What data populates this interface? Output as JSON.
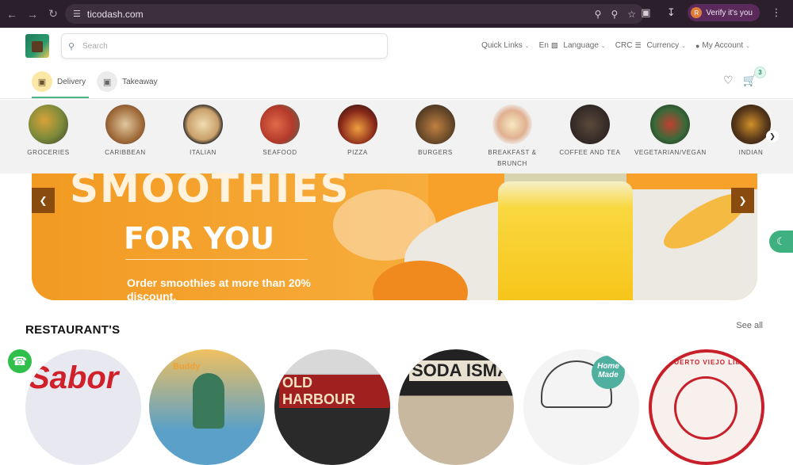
{
  "browser": {
    "url": "ticodash.com",
    "verify_label": "Verify it's you",
    "verify_avatar": "R"
  },
  "header": {
    "search_placeholder": "Search",
    "nav": {
      "quick_links": "Quick Links",
      "lang_code": "En",
      "language": "Language",
      "currency_code": "CRC",
      "currency": "Currency",
      "account": "My Account"
    },
    "modes": [
      {
        "label": "Delivery",
        "active": true
      },
      {
        "label": "Takeaway",
        "active": false
      }
    ],
    "cart_count": "3"
  },
  "categories": [
    {
      "label": "GROCERIES",
      "color": "#7a8a3a"
    },
    {
      "label": "CARIBBEAN",
      "color": "#a06b3a"
    },
    {
      "label": "ITALIAN",
      "color": "#c9a06a"
    },
    {
      "label": "SEAFOOD",
      "color": "#b33a2a"
    },
    {
      "label": "PIZZA",
      "color": "#8a2a1a"
    },
    {
      "label": "BURGERS",
      "color": "#6a4a2a"
    },
    {
      "label": "BREAKFAST & BRUNCH",
      "color": "#e0b090"
    },
    {
      "label": "COFFEE AND TEA",
      "color": "#3a2e2a"
    },
    {
      "label": "VEGETARIAN/VEGAN",
      "color": "#3a6a3a"
    },
    {
      "label": "INDIAN",
      "color": "#5a3a1a"
    }
  ],
  "banner": {
    "title_line1": "SMOOTHIES",
    "title_line2": "FOR YOU",
    "subtitle": "Order smoothies at more than 20% discount."
  },
  "restaurants": {
    "title": "RESTAURANT'S",
    "see_all": "See all",
    "items": [
      {
        "name": "Sabor",
        "bg": "#e8e8f0",
        "fg": "#d0202a"
      },
      {
        "name": "Buddy",
        "bg": "#5aa0c8",
        "fg": "#f0a030"
      },
      {
        "name": "OLD HARBOUR",
        "bg": "#2a2a2a",
        "fg": "#f0e0c0"
      },
      {
        "name": "SODA ISMA",
        "bg": "#c8b8a0",
        "fg": "#222222"
      },
      {
        "name": "Home Made",
        "bg": "#f4f4f4",
        "fg": "#4fb0a0"
      },
      {
        "name": "PUERTO VIEJO LIMON",
        "bg": "#f8f0ec",
        "fg": "#c8202a"
      }
    ]
  },
  "colors": {
    "accent": "#3fb07f",
    "banner_orange": "#f7a12a"
  }
}
